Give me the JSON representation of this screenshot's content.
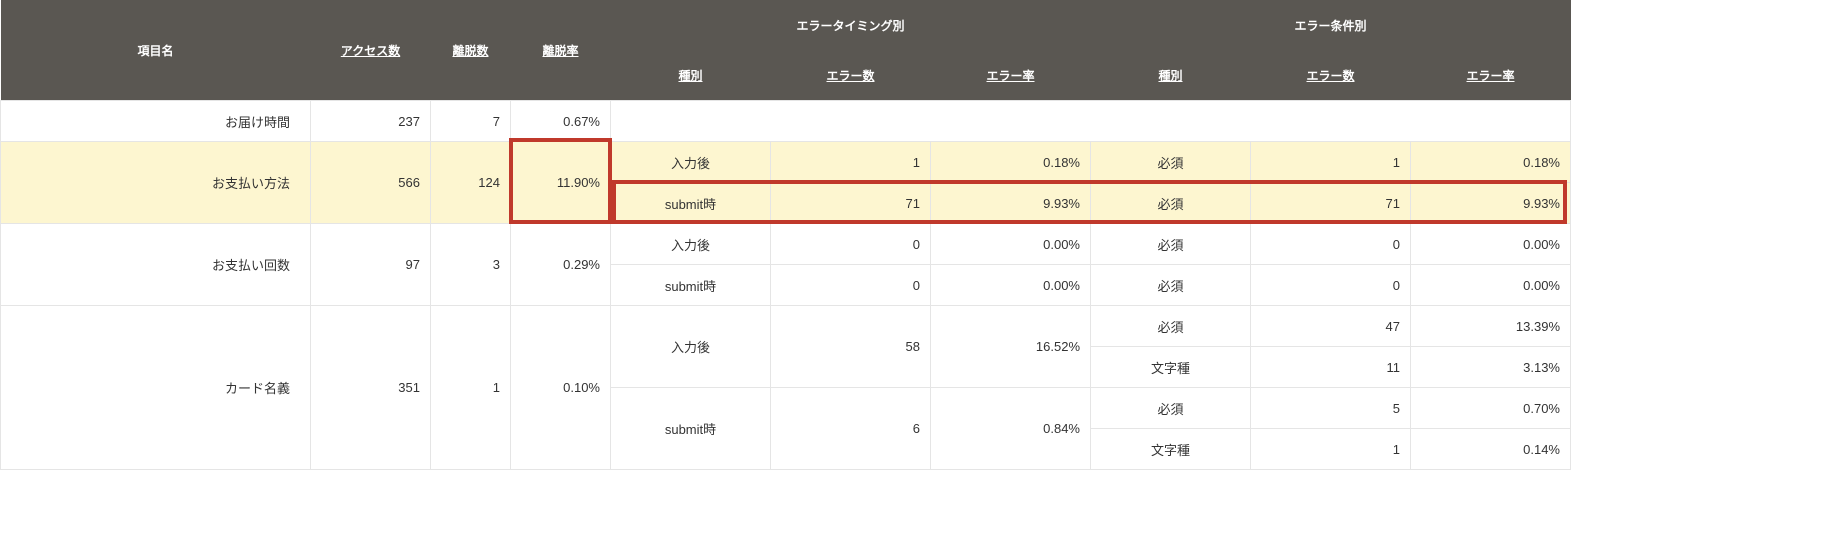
{
  "headers": {
    "item": "項目名",
    "access": "アクセス数",
    "dropCount": "離脱数",
    "dropRate": "離脱率",
    "timingGroup": "エラータイミング別",
    "condGroup": "エラー条件別",
    "type": "種別",
    "errCount": "エラー数",
    "errRate": "エラー率"
  },
  "rows": {
    "r0_item": "お届け時間",
    "r0_access": "237",
    "r0_dropn": "7",
    "r0_dropr": "0.67%",
    "r1_item": "お支払い方法",
    "r1_access": "566",
    "r1_dropn": "124",
    "r1_dropr": "11.90%",
    "r1a_t1": "入力後",
    "r1a_en1": "1",
    "r1a_er1": "0.18%",
    "r1a_t2": "必須",
    "r1a_en2": "1",
    "r1a_er2": "0.18%",
    "r1b_t1": "submit時",
    "r1b_en1": "71",
    "r1b_er1": "9.93%",
    "r1b_t2": "必須",
    "r1b_en2": "71",
    "r1b_er2": "9.93%",
    "r2_item": "お支払い回数",
    "r2_access": "97",
    "r2_dropn": "3",
    "r2_dropr": "0.29%",
    "r2a_t1": "入力後",
    "r2a_en1": "0",
    "r2a_er1": "0.00%",
    "r2a_t2": "必須",
    "r2a_en2": "0",
    "r2a_er2": "0.00%",
    "r2b_t1": "submit時",
    "r2b_en1": "0",
    "r2b_er1": "0.00%",
    "r2b_t2": "必須",
    "r2b_en2": "0",
    "r2b_er2": "0.00%",
    "r3_item": "カード名義",
    "r3_access": "351",
    "r3_dropn": "1",
    "r3_dropr": "0.10%",
    "r3a_t1": "入力後",
    "r3a_en1": "58",
    "r3a_er1": "16.52%",
    "r3a1_t2": "必須",
    "r3a1_en2": "47",
    "r3a1_er2": "13.39%",
    "r3a2_t2": "文字種",
    "r3a2_en2": "11",
    "r3a2_er2": "3.13%",
    "r3b_t1": "submit時",
    "r3b_en1": "6",
    "r3b_er1": "0.84%",
    "r3b1_t2": "必須",
    "r3b1_en2": "5",
    "r3b1_er2": "0.70%",
    "r3b2_t2": "文字種",
    "r3b2_en2": "1",
    "r3b2_er2": "0.14%"
  }
}
